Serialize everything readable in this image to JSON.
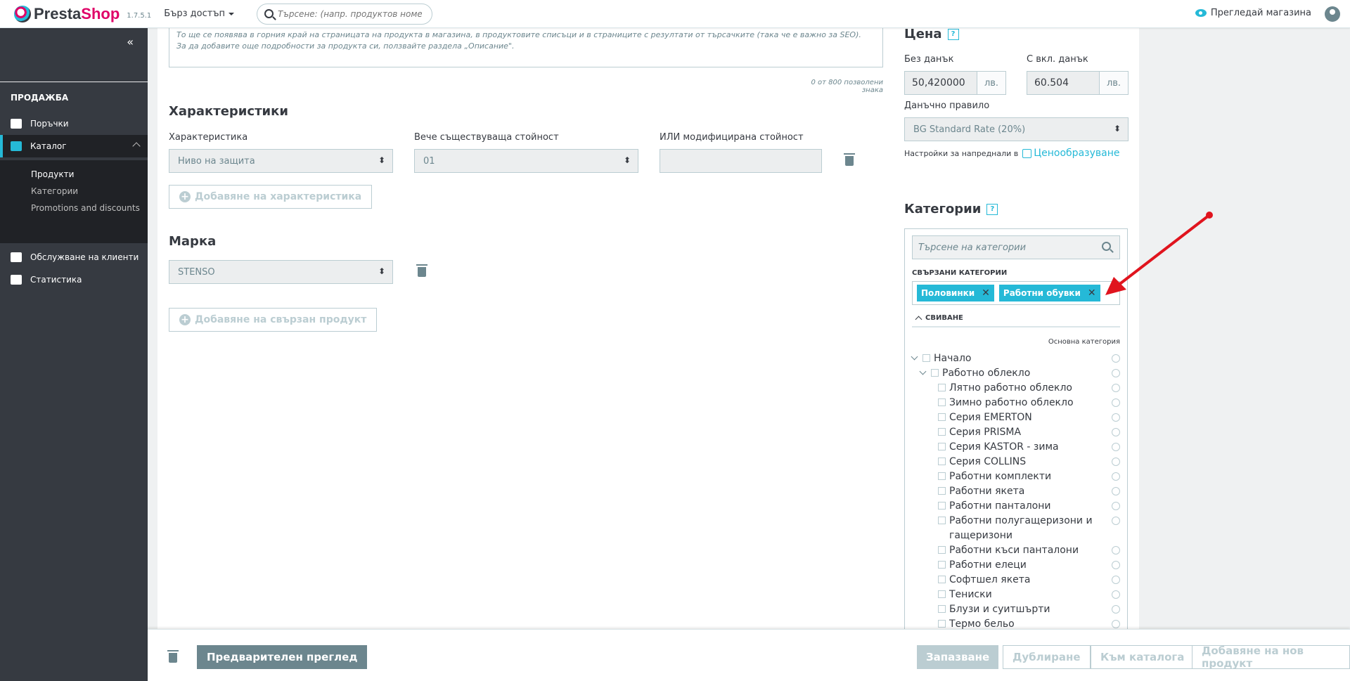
{
  "header": {
    "logo_prefix": "Presta",
    "logo_suffix": "Shop",
    "version": "1.7.5.1",
    "quick_access": "Бърз достъп",
    "search_placeholder": "Търсене: (напр. продуктов номер, им",
    "view_shop": "Прегледай магазина"
  },
  "sidebar": {
    "section": "ПРОДАЖБА",
    "items": [
      {
        "label": "Поръчки",
        "icon": "basket-icon"
      },
      {
        "label": "Каталог",
        "icon": "store-icon"
      },
      {
        "label": "Обслужване на клиенти",
        "icon": "chat-icon"
      },
      {
        "label": "Статистика",
        "icon": "bar-chart-icon"
      }
    ],
    "sub_items": [
      "Продукти",
      "Категории",
      "Promotions and discounts"
    ]
  },
  "main": {
    "help_text_line1": "То ще се появява в горния край на страницата на продукта в магазина, в продуктовите списъци и в страниците с резултати от търсачките (така че е важно за SEO).",
    "help_text_line2": "За да добавите още подробности за продукта си, ползвайте раздела „Описание\".",
    "counter": "0 от 800 позволени знака",
    "features": {
      "title": "Характеристики",
      "col_feature": "Характеристика",
      "col_existing": "Вече съществуваща стойност",
      "col_custom": "ИЛИ модифицирана стойност",
      "feature_value": "Ниво на защита",
      "existing_value": "01",
      "add_button": "Добавяне на характеристика"
    },
    "brand": {
      "title": "Марка",
      "value": "STENSO",
      "add_related": "Добавяне на свързан продукт"
    }
  },
  "price": {
    "title": "Цена",
    "help": "?",
    "tax_excl_label": "Без данък",
    "tax_excl_value": "50,420000",
    "tax_incl_label": "С вкл. данък",
    "tax_incl_value": "60.504",
    "currency": "лв.",
    "tax_rule_label": "Данъчно правило",
    "tax_rule_value": "BG Standard Rate (20%)",
    "advanced_prefix": "Настройки за напреднали в",
    "advanced_link": "Ценообразуване"
  },
  "categories": {
    "title": "Категории",
    "help": "?",
    "search_placeholder": "Търсене на категории",
    "associated_label": "СВЪРЗАНИ КАТЕГОРИИ",
    "tags": [
      "Половинки",
      "Работни обувки"
    ],
    "collapse_label": "СВИВАНЕ",
    "main_category_label": "Основна категория",
    "tree": [
      {
        "label": "Начало",
        "level": 0,
        "expandable": true
      },
      {
        "label": "Работно облекло",
        "level": 1,
        "expandable": true
      },
      {
        "label": "Лятно работно облекло",
        "level": 2
      },
      {
        "label": "Зимно работно облекло",
        "level": 2
      },
      {
        "label": "Серия EMERTON",
        "level": 2
      },
      {
        "label": "Серия PRISMA",
        "level": 2
      },
      {
        "label": "Серия KASTOR - зима",
        "level": 2
      },
      {
        "label": "Серия COLLINS",
        "level": 2
      },
      {
        "label": "Работни комплекти",
        "level": 2
      },
      {
        "label": "Работни якета",
        "level": 2
      },
      {
        "label": "Работни панталони",
        "level": 2
      },
      {
        "label": "Работни полугащеризони и гащеризони",
        "level": 2
      },
      {
        "label": "Работни къси панталони",
        "level": 2
      },
      {
        "label": "Работни елеци",
        "level": 2
      },
      {
        "label": "Софтшел якета",
        "level": 2
      },
      {
        "label": "Тениски",
        "level": 2
      },
      {
        "label": "Блузи и суитшърти",
        "level": 2
      },
      {
        "label": "Термо бельо",
        "level": 2
      }
    ]
  },
  "footer": {
    "preview": "Предварителен преглед",
    "save": "Запазване",
    "duplicate": "Дублиране",
    "to_catalog": "Към каталога",
    "add_new": "Добавяне на нов продукт"
  },
  "colors": {
    "accent": "#25b9d7",
    "brand_pink": "#df0067",
    "sidebar_bg": "#363a41",
    "annotation_arrow": "#e0141e"
  }
}
